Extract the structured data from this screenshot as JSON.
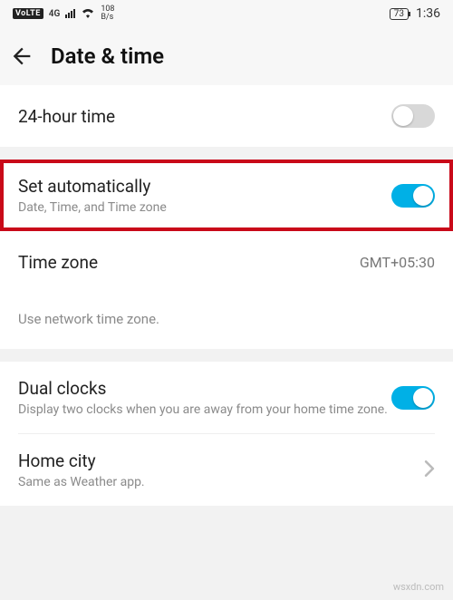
{
  "statusbar": {
    "volte": "VoLTE",
    "network": "4G",
    "speed_top": "108",
    "speed_bottom": "B/s",
    "battery": "73",
    "time": "1:36"
  },
  "header": {
    "title": "Date & time"
  },
  "rows": {
    "twentyfour": {
      "title": "24-hour time",
      "on": false
    },
    "set_auto": {
      "title": "Set automatically",
      "subtitle": "Date, Time, and Time zone",
      "on": true
    },
    "timezone": {
      "title": "Time zone",
      "value": "GMT+05:30"
    },
    "tz_hint": "Use network time zone.",
    "dual_clocks": {
      "title": "Dual clocks",
      "subtitle": "Display two clocks when you are away from your home time zone.",
      "on": true
    },
    "home_city": {
      "title": "Home city",
      "subtitle": "Same as Weather app."
    }
  },
  "watermark": "wsxdn.com"
}
